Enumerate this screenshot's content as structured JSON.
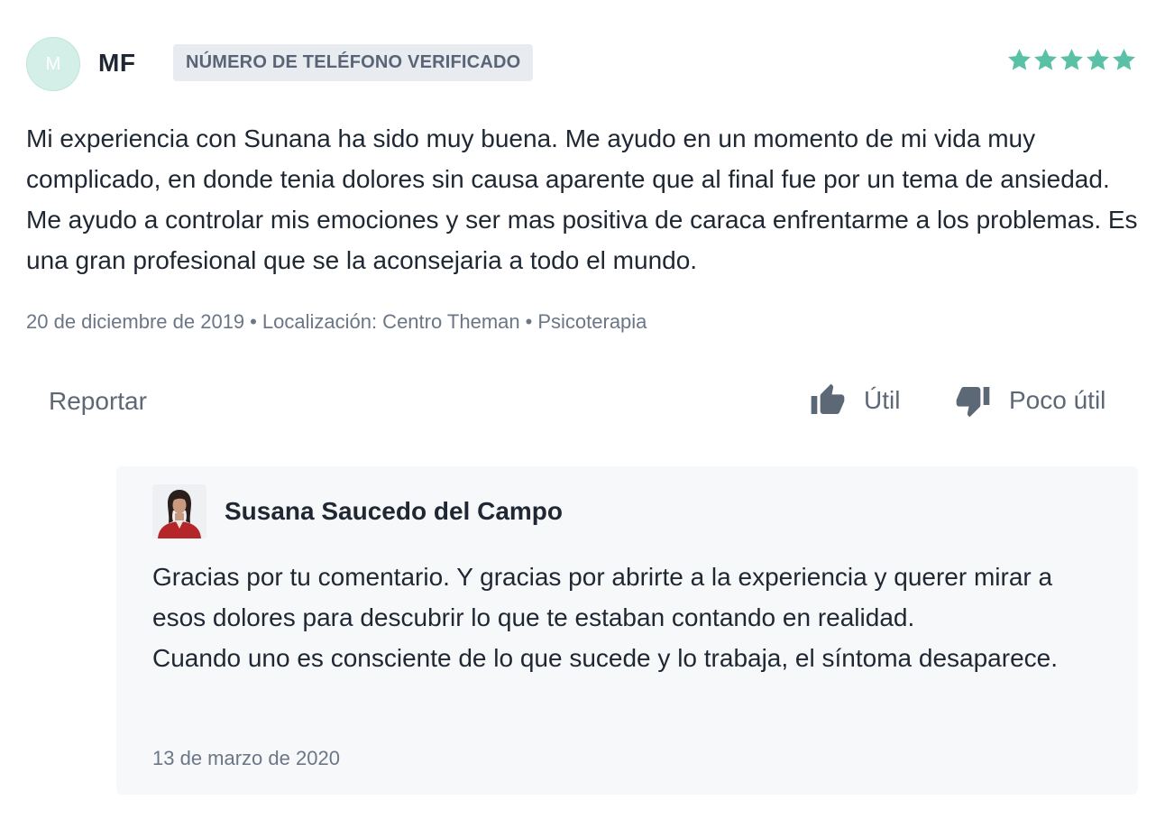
{
  "review": {
    "avatar_initial": "M",
    "author": "MF",
    "badge": "NÚMERO DE TELÉFONO VERIFICADO",
    "rating": 5,
    "rating_max": 5,
    "star_color": "#5ac1a6",
    "text": "Mi experiencia con Sunana ha sido muy buena. Me ayudo en un momento de mi vida muy complicado, en donde tenia dolores sin causa aparente que al final fue por un tema de ansiedad. Me ayudo a controlar mis emociones y ser mas positiva de caraca enfrentarme a los problemas. Es una gran profesional que se la aconsejaria a todo el mundo.",
    "date": "20 de diciembre de 2019",
    "location": "Localización: Centro Theman",
    "service": "Psicoterapia"
  },
  "actions": {
    "report_label": "Reportar",
    "useful_label": "Útil",
    "not_useful_label": "Poco útil",
    "useful_icon": "thumbs-up-icon",
    "not_useful_icon": "thumbs-down-icon"
  },
  "reply": {
    "author": "Susana Saucedo del Campo",
    "photo": "doctor-photo",
    "text_lines": [
      "Gracias por tu comentario. Y gracias por abrirte a la experiencia y querer mirar a esos dolores para descubrir lo que te estaban contando en realidad.",
      "Cuando uno es consciente de lo que sucede y lo trabaja, el síntoma desaparece."
    ],
    "date": "13 de marzo de 2020"
  }
}
